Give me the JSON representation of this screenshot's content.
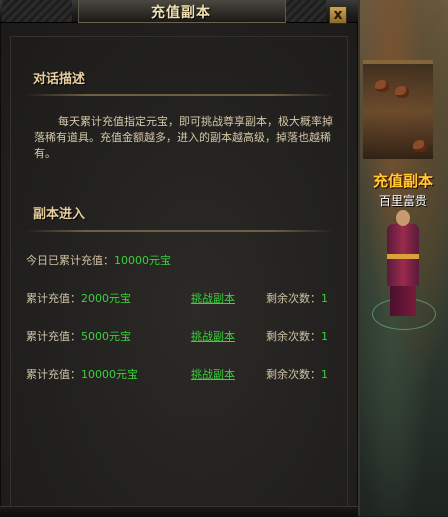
{
  "window": {
    "title": "充值副本",
    "close_label": "x"
  },
  "dialog_section": {
    "title": "对话描述",
    "text": "每天累计充值指定元宝，即可挑战尊享副本，极大概率掉落稀有道具。充值金额越多，进入的副本越高级，掉落也越稀有。"
  },
  "entry_section": {
    "title": "副本进入",
    "today_label": "今日已累计充值：",
    "today_value": "10000元宝",
    "rows": [
      {
        "label": "累计充值：",
        "value": "2000元宝",
        "action": "挑战副本",
        "remain_label": "剩余次数：",
        "remain_value": "1"
      },
      {
        "label": "累计充值：",
        "value": "5000元宝",
        "action": "挑战副本",
        "remain_label": "剩余次数：",
        "remain_value": "1"
      },
      {
        "label": "累计充值：",
        "value": "10000元宝",
        "action": "挑战副本",
        "remain_label": "剩余次数：",
        "remain_value": "1"
      }
    ]
  },
  "npc": {
    "title": "充值副本",
    "name": "百里富贵"
  },
  "colors": {
    "accent_green": "#39d33a",
    "title_gold": "#e9cfa0",
    "npc_title": "#ffcc33"
  }
}
